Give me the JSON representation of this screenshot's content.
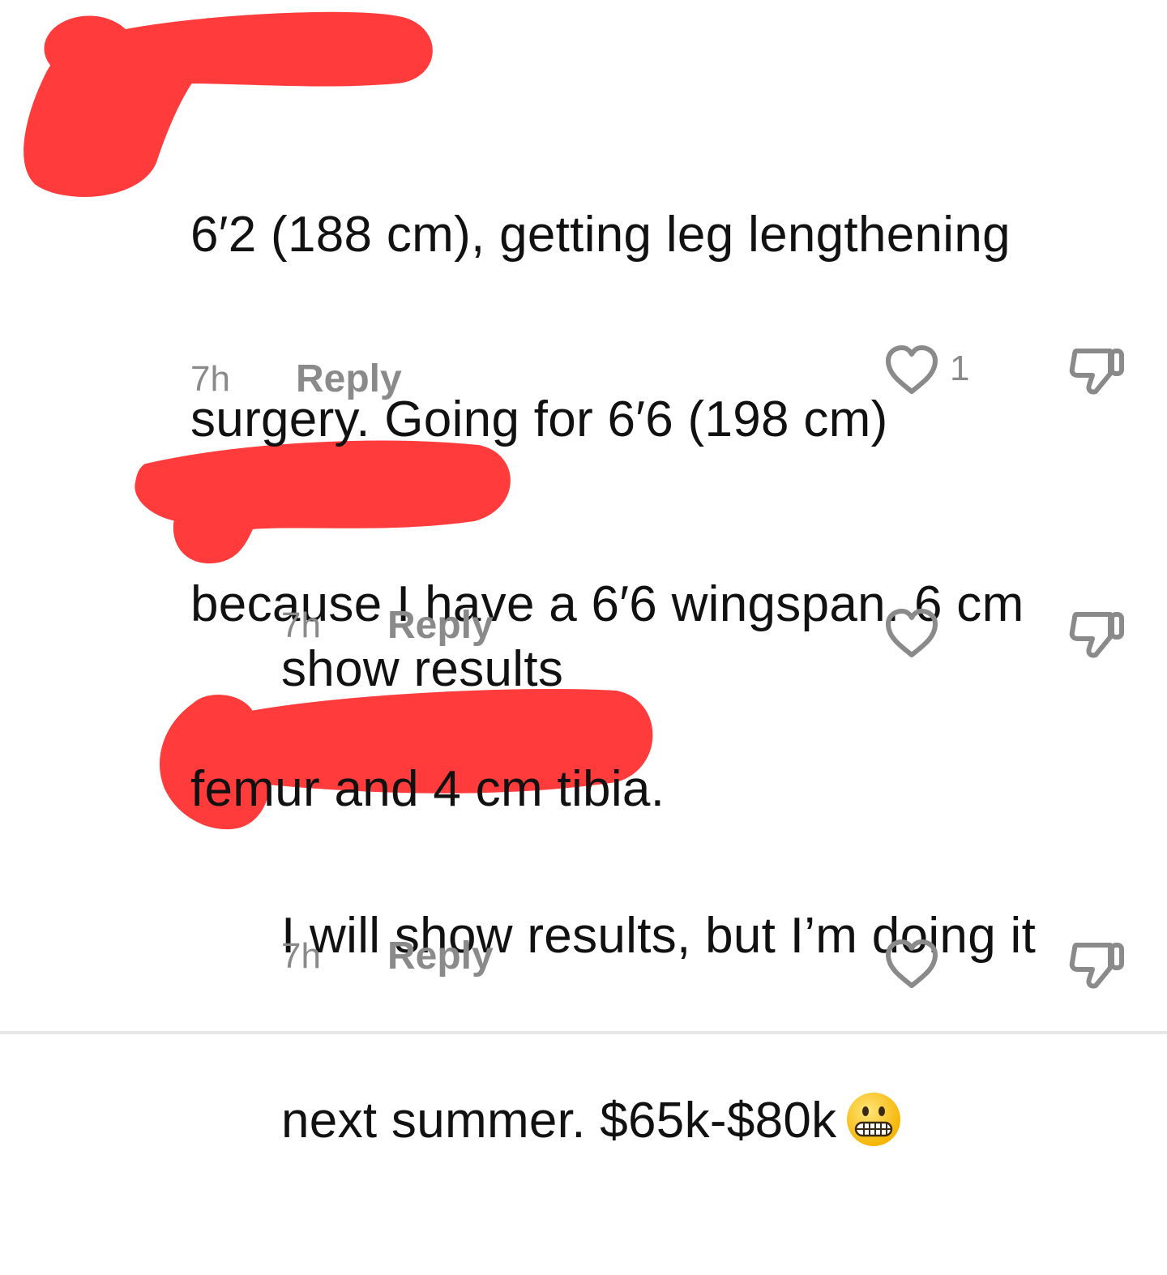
{
  "comments": [
    {
      "text_lines": [
        "6′2 (188 cm), getting leg lengthening",
        "surgery. Going for 6′6 (198 cm)",
        "because I have a 6′6 wingspan. 6 cm",
        "femur and 4 cm tibia."
      ],
      "time": "7h",
      "reply_label": "Reply",
      "like_count": "1"
    },
    {
      "text_lines": [
        "show results"
      ],
      "time": "7h",
      "reply_label": "Reply",
      "like_count": ""
    },
    {
      "text_lines": [
        "I will show results, but I’m doing it",
        "next summer. $65k-$80k"
      ],
      "time": "7h",
      "reply_label": "Reply",
      "like_count": "",
      "emoji": "grimacing-face"
    }
  ],
  "colors": {
    "redaction": "#ff3b3b",
    "meta_gray": "#8a8a8a",
    "text": "#111111"
  },
  "icons": {
    "like": "heart-outline-icon",
    "dislike": "thumbs-down-outline-icon"
  }
}
